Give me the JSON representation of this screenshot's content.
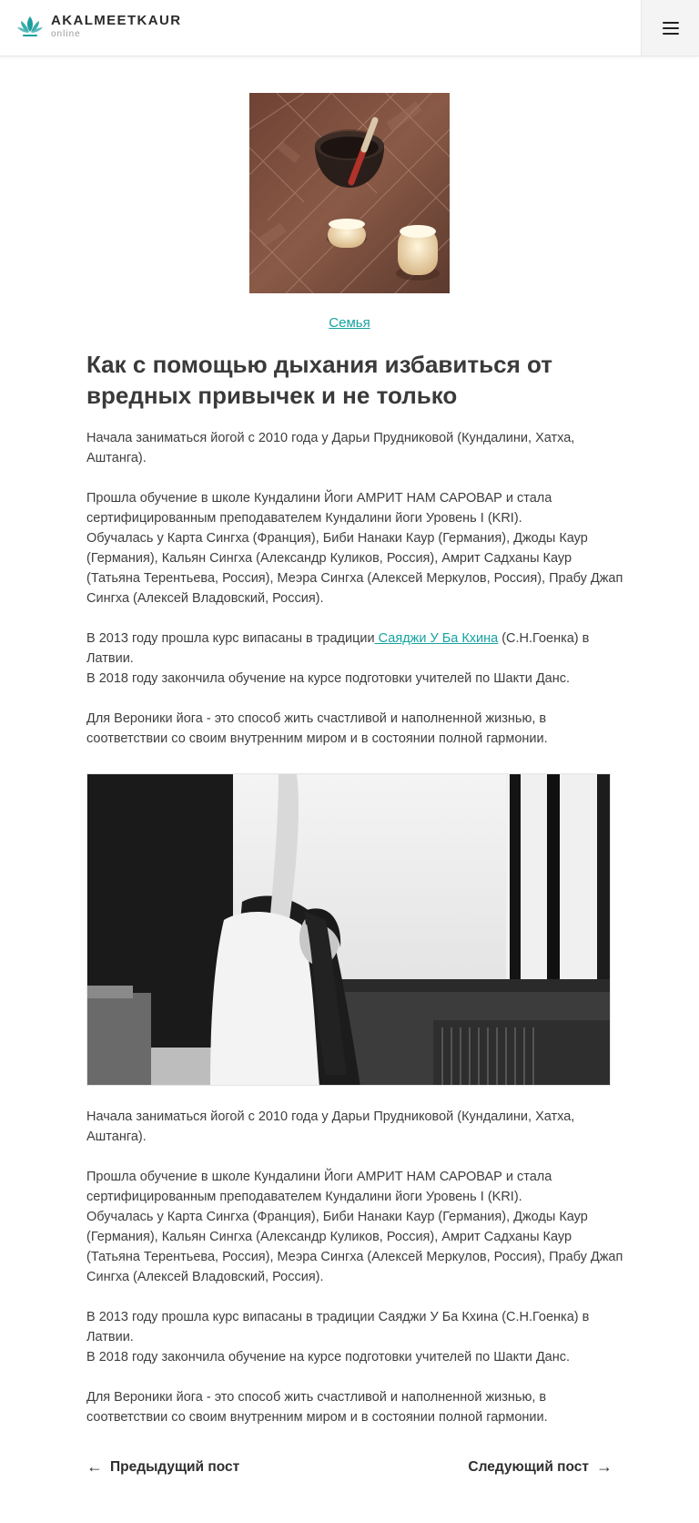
{
  "header": {
    "logo_name": "AKALMEETKAUR",
    "logo_sub": "online",
    "menu_icon": "hamburger-icon"
  },
  "post": {
    "category": "Семья",
    "title": "Как с помощью дыхания избавиться от вредных привычек и не только",
    "section1": {
      "p1": "Начала заниматься йогой с 2010 года у Дарьи  Прудниковой (Кундалини, Хатха, Аштанга).",
      "p2a": "Прошла обучение в школе  Кундалини  Йоги АМРИТ  НАМ САРОВАР и стала сертифицированным преподавателем  Кундалини йоги Уровень I (KRI).",
      "p2b": "Обучалась у  Карта Сингха (Франция),  Биби  Нанаки  Каур (Германия), Джоды Каур (Германия),  Кальян Сингха (Александр  Куликов,  Россия), Амрит Садханы Каур (Татьяна Терентьева,  Россия),  Меэра Сингха (Алексей  Меркулов,  Россия), Прабу Джап Сингха (Алексей  Владовский,  Россия).",
      "p3_before": "В 2013 году прошла курс випасаны в традиции",
      "p3_link": " Саяджи У  Ба  Кхина",
      "p3_after": " (С.Н.Гоенка) в Латвии.",
      "p4": "В 2018 году закончила обучение на курсе подготовки учителей по  Шакти Данс.",
      "p5": "Для  Вероники йога - это способ жить счастливой и наполненной жизнью, в соответствии со своим внутренним миром и в состоянии полной гармонии."
    },
    "section2": {
      "p1": "Начала заниматься йогой с 2010 года у Дарьи  Прудниковой (Кундалини, Хатха, Аштанга).",
      "p2a": "Прошла обучение в школе  Кундалини  Йоги АМРИТ  НАМ САРОВАР и стала сертифицированным преподавателем  Кундалини йоги Уровень I (KRI).",
      "p2b": "Обучалась у  Карта Сингха (Франция),  Биби  Нанаки  Каур (Германия), Джоды Каур (Германия),  Кальян Сингха (Александр  Куликов,  Россия), Амрит Садханы Каур (Татьяна Терентьева,  Россия),  Меэра Сингха (Алексей  Меркулов,  Россия), Прабу Джап Сингха (Алексей  Владовский,  Россия).",
      "p3": "В 2013 году прошла курс випасаны в традиции Саяджи У  Ба  Кхина (С.Н.Гоенка) в Латвии.",
      "p4": "В 2018 году закончила обучение на курсе подготовки учителей по  Шакти Данс.",
      "p5": "Для  Вероники йога - это способ жить счастливой и наполненной жизнью, в соответствии со своим внутренним миром и в состоянии полной гармонии."
    }
  },
  "navigation": {
    "prev_label": "Предыдущий пост",
    "prev_arrow": "←",
    "next_label": "Следующий пост",
    "next_arrow": "→"
  },
  "colors": {
    "accent": "#17a2a2",
    "text": "#3a3a3a"
  }
}
